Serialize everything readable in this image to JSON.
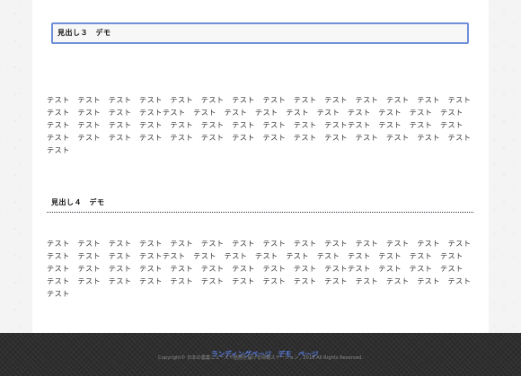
{
  "heading3": "見出し３　デモ",
  "paragraph1": "テスト　テスト　テスト　テスト　テスト　テスト　テスト　テスト　テスト　テスト　テスト　テスト　テスト　テスト　テスト　テスト　テスト　テストテスト　テスト　テスト　テスト　テスト　テスト　テスト　テスト　テスト　テスト　テスト　テスト　テスト　テスト　テスト　テスト　テスト　テスト　テスト　テストテスト　テスト　テスト　テスト　テスト　テスト　テスト　テスト　テスト　テスト　テスト　テスト　テスト　テスト　テスト　テスト　テスト　テスト　テスト",
  "heading4": "見出し４　デモ",
  "paragraph2": "テスト　テスト　テスト　テスト　テスト　テスト　テスト　テスト　テスト　テスト　テスト　テスト　テスト　テスト　テスト　テスト　テスト　テストテスト　テスト　テスト　テスト　テスト　テスト　テスト　テスト　テスト　テスト　テスト　テスト　テスト　テスト　テスト　テスト　テスト　テスト　テスト　テストテスト　テスト　テスト　テスト　テスト　テスト　テスト　テスト　テスト　テスト　テスト　テスト　テスト　テスト　テスト　テスト　テスト　テスト　テスト",
  "footer": {
    "nav_label": "ランディングページ　デモ　ページ",
    "copyright": "Copyright© 日本の農業ニュースや話題を届ける情報ステーション , 2018 All Rights Reserved."
  }
}
